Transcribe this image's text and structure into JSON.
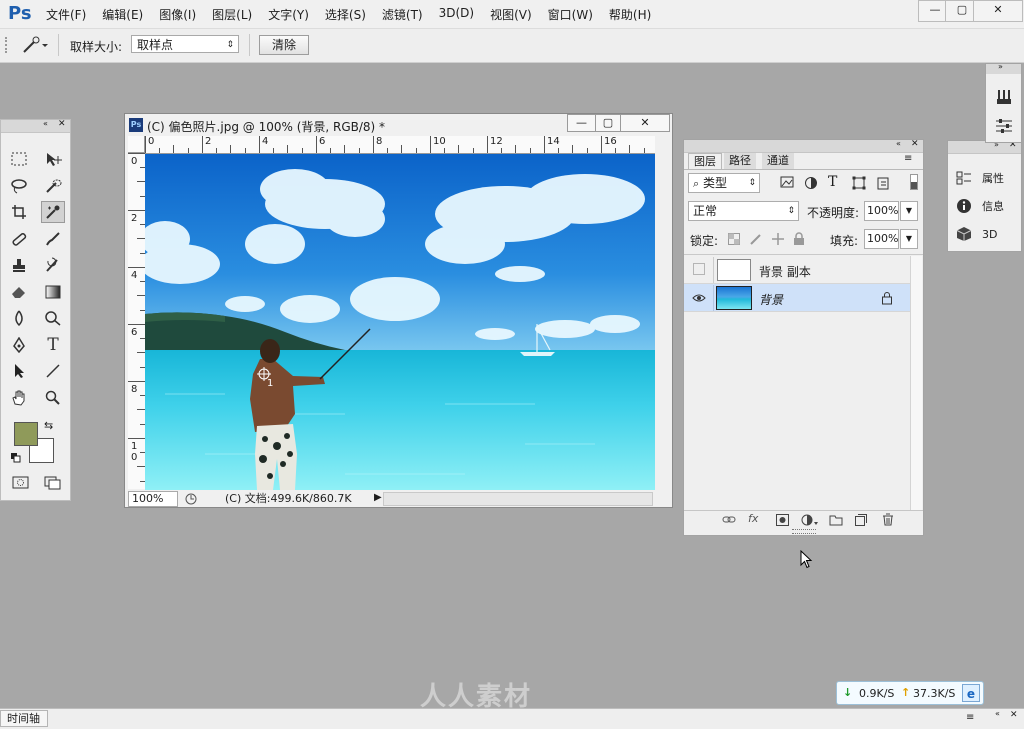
{
  "app": {
    "logo": "Ps"
  },
  "menu": [
    "文件(F)",
    "编辑(E)",
    "图像(I)",
    "图层(L)",
    "文字(Y)",
    "选择(S)",
    "滤镜(T)",
    "3D(D)",
    "视图(V)",
    "窗口(W)",
    "帮助(H)"
  ],
  "window_controls": [
    "—",
    "▢",
    "✕"
  ],
  "options_bar": {
    "sample_size_label": "取样大小:",
    "sample_size_value": "取样点",
    "clear_button": "清除"
  },
  "document": {
    "title": "(C) 偏色照片.jpg @ 100% (背景, RGB/8) *",
    "ruler_h": [
      "0",
      "2",
      "4",
      "6",
      "8",
      "10",
      "12",
      "14",
      "16"
    ],
    "ruler_v": [
      "0",
      "2",
      "4",
      "6",
      "8",
      "1\n0"
    ],
    "zoom": "100%",
    "doc_info": "(C) 文档:499.6K/860.7K",
    "sampler_marker": "1",
    "controls": [
      "—",
      "▢",
      "✕"
    ]
  },
  "layers_panel": {
    "tabs": [
      "图层",
      "路径",
      "通道"
    ],
    "filter_type": "类型",
    "blend_mode": "正常",
    "opacity_label": "不透明度:",
    "opacity_value": "100%",
    "lock_label": "锁定:",
    "fill_label": "填充:",
    "fill_value": "100%",
    "layers": [
      {
        "name": "背景 副本",
        "visible": false
      },
      {
        "name": "背景",
        "visible": true,
        "selected": true,
        "locked": true
      }
    ],
    "footer_icons": [
      "link-icon",
      "fx-icon",
      "mask-icon",
      "adjustment-icon",
      "group-icon",
      "new-layer-icon",
      "delete-icon"
    ]
  },
  "props_panel": {
    "items": [
      "属性",
      "信息",
      "3D"
    ]
  },
  "timeline": {
    "label": "时间轴"
  },
  "net_monitor": {
    "download": "0.9K/S",
    "upload": "37.3K/S"
  },
  "watermark": "人人素材",
  "colors": {
    "foreground": "#8f9a5a",
    "background": "#ffffff",
    "selected_layer": "#cfe1f9",
    "ps_blue": "#1f5fae"
  }
}
